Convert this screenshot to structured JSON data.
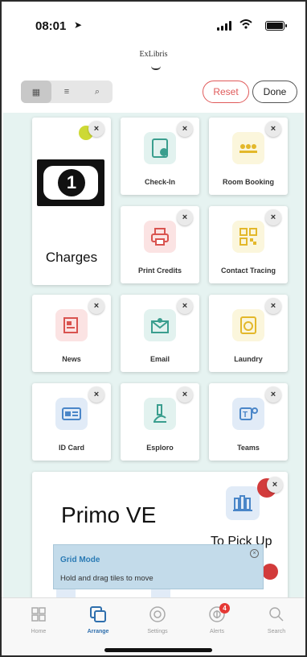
{
  "status_bar": {
    "time": "08:01",
    "location_glyph": "➤"
  },
  "header": {
    "logo": "ExLibris"
  },
  "toolbar": {
    "view_grid_icon": "▦",
    "view_list_icon": "≡",
    "search_icon": "⌕",
    "reset_label": "Reset",
    "done_label": "Done"
  },
  "tiles": {
    "charges": "Charges",
    "bill_number": "1",
    "checkin": "Check-In",
    "room_booking": "Room Booking",
    "print_credits": "Print Credits",
    "contact_tracing": "Contact Tracing",
    "news": "News",
    "email": "Email",
    "laundry": "Laundry",
    "id_card": "ID Card",
    "esploro": "Esploro",
    "teams": "Teams",
    "primo": "Primo VE",
    "to_pick_up": "To Pick Up",
    "close_glyph": "×"
  },
  "hint": {
    "title": "Grid Mode",
    "body": "Hold and drag tiles to move",
    "close_glyph": "×"
  },
  "tabbar": {
    "home": "Home",
    "arrange": "Arrange",
    "settings": "Settings",
    "alerts": "Alerts",
    "alerts_badge": "4",
    "search": "Search"
  },
  "colors": {
    "accent": "#2f6fad",
    "reset": "#e05a5a",
    "area_bg": "#e6f3f1"
  }
}
